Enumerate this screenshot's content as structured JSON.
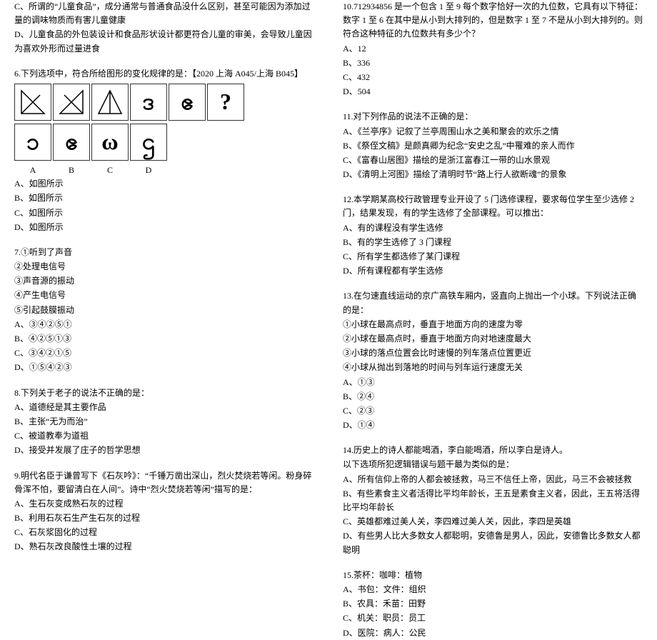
{
  "left": {
    "pre": {
      "c": "C、所谓的“儿童食品”，成分通常与普通食品没什么区别，甚至可能因为添加过量的调味物质而有害儿童健康",
      "d": "D、儿童食品的外包装设计和食品形状设计都更符合儿童的审美，会导致儿童因为喜欢外形而过量进食"
    },
    "q6": {
      "stem": "6.下列选项中，符合所给图形的变化规律的是：【2020 上海 A045/上海 B045】",
      "labels": [
        "A",
        "B",
        "C",
        "D"
      ],
      "opts": [
        "A、如图所示",
        "B、如图所示",
        "C、如图所示",
        "D、如图所示"
      ]
    },
    "q7": {
      "lines": [
        "7.①听到了声音",
        "②处理电信号",
        "③声音源的振动",
        "④产生电信号",
        "⑤引起鼓膜振动"
      ],
      "opts": [
        "A、③④②⑤①",
        "B、④②⑤①③",
        "C、③④②①⑤",
        "D、①⑤④②③"
      ]
    },
    "q8": {
      "stem": "8.下列关于老子的说法不正确的是：",
      "opts": [
        "A、道德经是其主要作品",
        "B、主张“无为而治”",
        "C、被道教奉为道祖",
        "D、接受并发展了庄子的哲学思想"
      ]
    },
    "q9": {
      "stem": "9.明代名臣于谦曾写下《石灰吟》：“千锤万凿出深山，烈火焚烧若等闲。粉身碎骨浑不怕，要留清白在人间”。诗中“烈火焚烧若等闲”描写的是：",
      "opts": [
        "A、生石灰变成熟石灰的过程",
        "B、利用石灰石生产生石灰的过程",
        "C、石灰浆固化的过程",
        "D、熟石灰改良酸性土壤的过程"
      ]
    }
  },
  "right": {
    "q10": {
      "stem": "10.712934856 是一个包含 1 至 9 每个数字恰好一次的九位数，它具有以下特征：数字 1 至 6 在其中是从小到大排列的，但是数字 1 至 7 不是从小到大排列的。则符合这种特征的九位数共有多少个？",
      "opts": [
        "A、12",
        "B、336",
        "C、432",
        "D、504"
      ]
    },
    "q11": {
      "stem": "11.对下列作品的说法不正确的是：",
      "opts": [
        "A、《兰亭序》记叙了兰亭周围山水之美和聚会的欢乐之情",
        "B、《祭侄文稿》是颜真卿为纪念“安史之乱”中罹难的亲人而作",
        "C、《富春山居图》描绘的是浙江富春江一带的山水景观",
        "D、《清明上河图》描绘了清明时节“路上行人欲断魂”的景象"
      ]
    },
    "q12": {
      "stem": "12.本学期某高校行政管理专业开设了 5 门选修课程，要求每位学生至少选修 2 门，结果发现，有的学生选修了全部课程。可以推出：",
      "opts": [
        "A、有的课程没有学生选修",
        "B、有的学生选修了 3 门课程",
        "C、所有学生都选修了某门课程",
        "D、所有课程都有学生选修"
      ]
    },
    "q13": {
      "stem": "13.在匀速直线运动的京广高铁车厢内，竖直向上抛出一个小球。下列说法正确的是：",
      "lines": [
        "①小球在最高点时，垂直于地面方向的速度为零",
        "②小球在最高点时，垂直于地面方向对地速度最大",
        "③小球的落点位置会比时速慢的列车落点位置更近",
        "④小球从抛出到落地的时间与列车运行速度无关"
      ],
      "opts": [
        "A、①③",
        "B、②④",
        "C、②③",
        "D、①④"
      ]
    },
    "q14": {
      "stem": "14.历史上的诗人都能喝酒，李白能喝酒，所以李白是诗人。",
      "sub": "以下选项所犯逻辑错误与题干最为类似的是：",
      "opts": [
        "A、所有信仰上帝的人都会被拯救，马三不信任上帝，因此，马三不会被拯救",
        "B、有些素食主义者活得比平均年龄长，王五是素食主义者，因此，王五将活得比平均年龄长",
        "C、英雄都难过美人关，李四难过美人关，因此，李四是英雄",
        "D、有些男人比大多数女人都聪明，安德鲁是男人，因此，安德鲁比多数女人都聪明"
      ]
    },
    "q15": {
      "stem": "15.茶杯：咖啡：植物",
      "opts": [
        "A、书包：文件：组织",
        "B、农具：禾苗：田野",
        "C、机关：职员：员工",
        "D、医院：病人：公民"
      ]
    }
  }
}
